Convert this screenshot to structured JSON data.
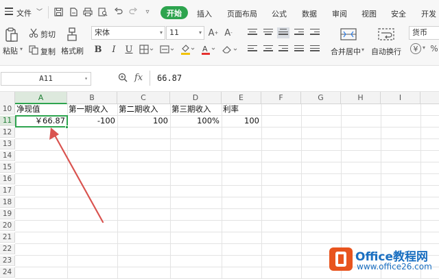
{
  "menubar": {
    "file_label": "文件",
    "tabs": [
      {
        "label": "开始",
        "active": true
      },
      {
        "label": "插入"
      },
      {
        "label": "页面布局"
      },
      {
        "label": "公式"
      },
      {
        "label": "数据"
      },
      {
        "label": "审阅"
      },
      {
        "label": "视图"
      },
      {
        "label": "安全"
      },
      {
        "label": "开发"
      }
    ],
    "accent_color": "#2da44e"
  },
  "ribbon": {
    "paste_label": "粘贴",
    "cut_label": "剪切",
    "copy_label": "复制",
    "format_painter_label": "格式刷",
    "font_name": "宋体",
    "font_size": "11",
    "merge_center_label": "合并居中",
    "wrap_text_label": "自动换行",
    "number_format": "货币"
  },
  "formula_bar": {
    "name_box": "A11",
    "fx_label": "fx",
    "value": "66.87"
  },
  "sheet": {
    "columns": [
      "A",
      "B",
      "C",
      "D",
      "E",
      "F",
      "G",
      "H",
      "I"
    ],
    "selected_column": "A",
    "rows": [
      "10",
      "11",
      "12",
      "13",
      "14",
      "15",
      "16",
      "17",
      "18",
      "19",
      "20",
      "21",
      "22",
      "23",
      "24"
    ],
    "selected_row": "11",
    "row10": {
      "A": "净现值",
      "B": "第一期收入",
      "C": "第二期收入",
      "D": "第三期收入",
      "E": "利率"
    },
    "row11": {
      "A": "￥66.87",
      "B": "-100",
      "C": "100",
      "D": "100%",
      "E": "100"
    },
    "annotation_arrow_color": "#d9534f"
  },
  "watermark": {
    "title": "Office教程网",
    "url": "www.office26.com"
  }
}
